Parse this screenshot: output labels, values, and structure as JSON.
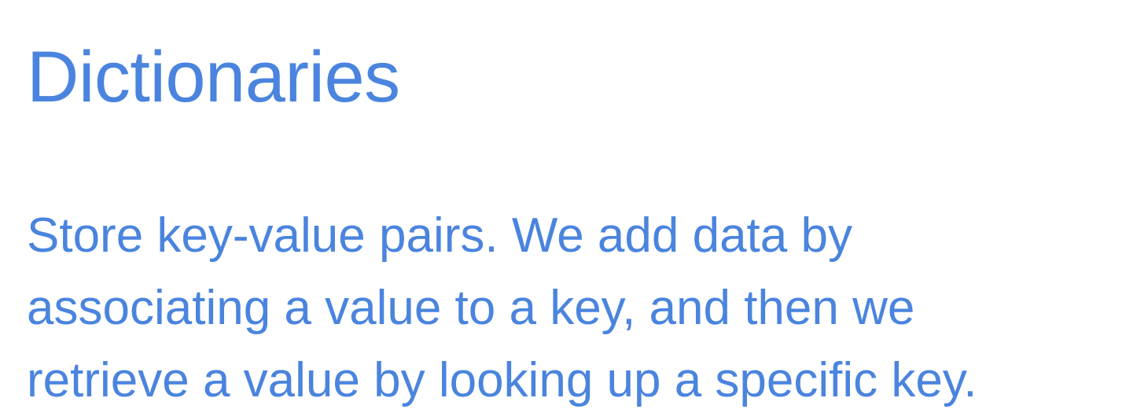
{
  "slide": {
    "title": "Dictionaries",
    "body_lines": [
      "Store key-value pairs. We add data by",
      "associating a value to a key, and then we",
      "retrieve a value by looking up a specific key."
    ]
  },
  "colors": {
    "background": "#ffffff",
    "text_accent": "#4a84de"
  }
}
